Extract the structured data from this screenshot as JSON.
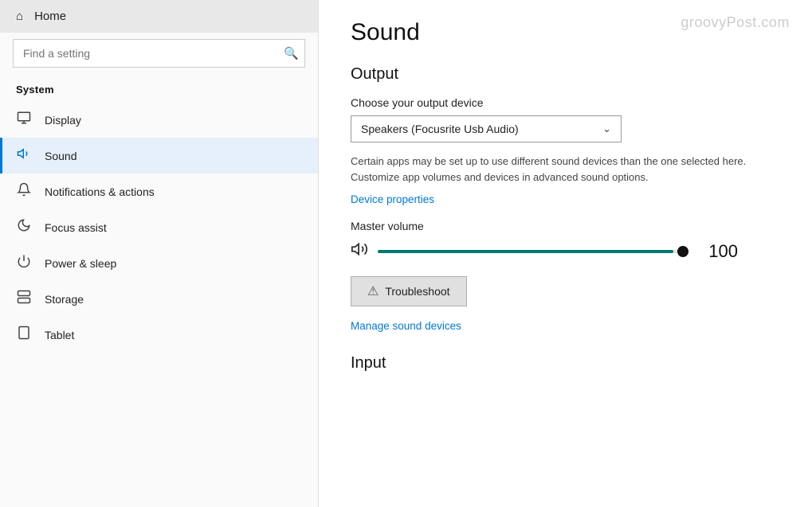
{
  "sidebar": {
    "home_label": "Home",
    "search_placeholder": "Find a setting",
    "section_label": "System",
    "nav_items": [
      {
        "id": "display",
        "label": "Display",
        "icon": "display"
      },
      {
        "id": "sound",
        "label": "Sound",
        "icon": "sound",
        "active": true
      },
      {
        "id": "notifications",
        "label": "Notifications & actions",
        "icon": "notif"
      },
      {
        "id": "focus",
        "label": "Focus assist",
        "icon": "focus"
      },
      {
        "id": "power",
        "label": "Power & sleep",
        "icon": "power"
      },
      {
        "id": "storage",
        "label": "Storage",
        "icon": "storage"
      },
      {
        "id": "tablet",
        "label": "Tablet",
        "icon": "tablet"
      }
    ]
  },
  "main": {
    "page_title": "Sound",
    "watermark": "groovyPost.com",
    "output_section": {
      "title": "Output",
      "device_label": "Choose your output device",
      "device_value": "Speakers (Focusrite Usb Audio)",
      "info_text": "Certain apps may be set up to use different sound devices than the one selected here. Customize app volumes and devices in advanced sound options.",
      "device_properties_link": "Device properties",
      "volume_label": "Master volume",
      "volume_value": "100",
      "troubleshoot_label": "Troubleshoot",
      "manage_devices_link": "Manage sound devices"
    },
    "input_section": {
      "title": "Input"
    }
  }
}
